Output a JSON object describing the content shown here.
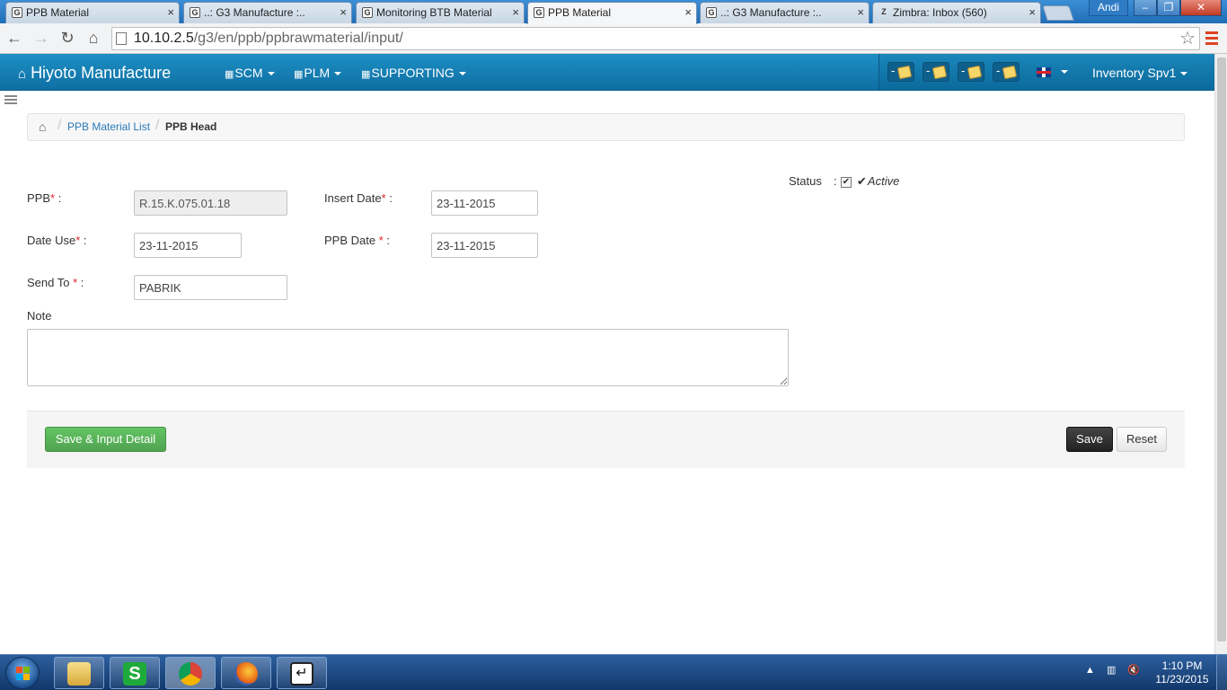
{
  "browser": {
    "tabs": [
      {
        "title": "PPB Material",
        "active": false
      },
      {
        "title": "..: G3 Manufacture :..",
        "active": false
      },
      {
        "title": "Monitoring BTB Material",
        "active": false
      },
      {
        "title": "PPB Material",
        "active": true
      },
      {
        "title": "..: G3 Manufacture :..",
        "active": false
      },
      {
        "title": "Zimbra: Inbox (560)",
        "active": false
      }
    ],
    "user_badge": "Andi",
    "url_host": "10.10.2.5",
    "url_path": "/g3/en/ppb/ppbrawmaterial/input/"
  },
  "navbar": {
    "brand": "Hiyoto Manufacture",
    "menus": [
      "SCM",
      "PLM",
      "SUPPORTING"
    ],
    "notifications": [
      "-",
      "-",
      "-",
      "-"
    ],
    "user": "Inventory Spv1"
  },
  "breadcrumb": {
    "list": "PPB Material List",
    "current": "PPB Head"
  },
  "form": {
    "ppb_label": "PPB",
    "ppb_value": "R.15.K.075.01.18",
    "insert_date_label": "Insert Date",
    "insert_date_value": "23-11-2015",
    "date_use_label": "Date Use",
    "date_use_value": "23-11-2015",
    "ppb_date_label": "PPB Date",
    "ppb_date_value": "23-11-2015",
    "send_to_label": "Send To",
    "send_to_value": "PABRIK",
    "note_label": "Note",
    "note_value": "",
    "status_label": "Status",
    "status_value": "Active",
    "status_checked": true,
    "required_mark": "*",
    "colon": ":"
  },
  "actions": {
    "save_input_detail": "Save & Input Detail",
    "save": "Save",
    "reset": "Reset"
  },
  "taskbar": {
    "time": "1:10 PM",
    "date": "11/23/2015"
  },
  "colors": {
    "navbar": "#1d8fc4",
    "link": "#2a7ab8",
    "required": "#d9232d",
    "green_button": "#5bb75b",
    "dark_button": "#333333"
  }
}
